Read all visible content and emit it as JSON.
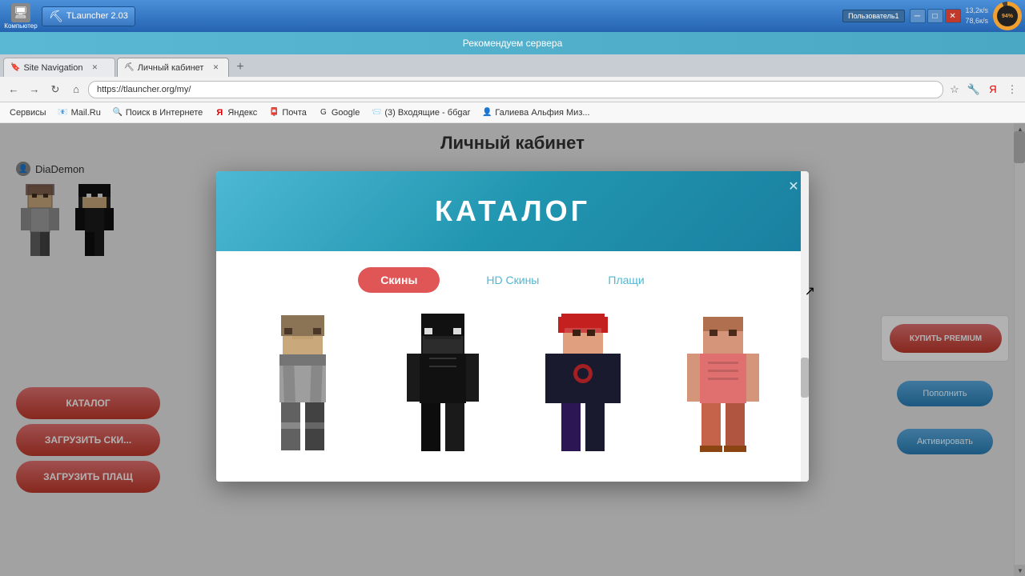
{
  "taskbar": {
    "desktop_label": "Компьютер",
    "tlauncher_label": "TLauncher 2.03",
    "user_btn_label": "Пользователь1",
    "recommend_text": "Рекомендуем сервера",
    "cpu_percent": "94%",
    "network_down": "13,2к/s",
    "network_up": "78,6к/s"
  },
  "browser": {
    "tab1_label": "Site Navigation",
    "tab2_label": "Личный кабинет",
    "address": "https://tlauncher.org/my/",
    "bookmarks": [
      {
        "label": "Сервисы"
      },
      {
        "label": "Mail.Ru"
      },
      {
        "label": "Поиск в Интернете"
      },
      {
        "label": "Яндекс"
      },
      {
        "label": "Почта"
      },
      {
        "label": "Google"
      },
      {
        "label": "(3) Входящие - ббgar"
      },
      {
        "label": "Галиева Альфия Миз..."
      }
    ]
  },
  "page": {
    "title": "Личный кабинет",
    "username": "DiaDemon",
    "buttons": {
      "catalog": "КАТАЛОГ",
      "upload_skin": "ЗАГРУЗИТЬ СКИ...",
      "upload_cloak": "ЗАГРУЗИТЬ ПЛАЩ",
      "premium": "КУПИТЬ PREMIUM",
      "replenish": "Пополнить",
      "activate": "Активировать"
    }
  },
  "catalog_modal": {
    "title": "КАТАЛОГ",
    "tabs": [
      {
        "label": "Скины",
        "active": true
      },
      {
        "label": "HD Скины",
        "active": false
      },
      {
        "label": "Плащи",
        "active": false
      }
    ],
    "skins": [
      {
        "id": 1,
        "color_head": "#9e9e9e",
        "color_body": "#757575",
        "color_legs": "#616161"
      },
      {
        "id": 2,
        "color_head": "#212121",
        "color_body": "#1a1a1a",
        "color_legs": "#111111"
      },
      {
        "id": 3,
        "color_head": "#c62828",
        "color_body": "#1a1a2e",
        "color_legs": "#2c1654"
      },
      {
        "id": 4,
        "color_head": "#d4957a",
        "color_body": "#e07070",
        "color_legs": "#c4634a"
      }
    ]
  }
}
